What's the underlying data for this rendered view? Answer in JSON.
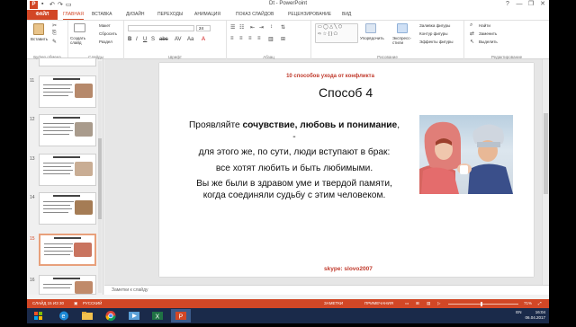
{
  "window": {
    "title": "Dt - PowerPoint",
    "app_icon": "P",
    "controls": [
      "?",
      "—",
      "❐",
      "✕"
    ]
  },
  "tabs": {
    "file": "ФАЙЛ",
    "items": [
      {
        "label": "ГЛАВНАЯ",
        "active": true
      },
      {
        "label": "ВСТАВКА"
      },
      {
        "label": "ДИЗАЙН"
      },
      {
        "label": "ПЕРЕХОДЫ"
      },
      {
        "label": "АНИМАЦИЯ"
      },
      {
        "label": "ПОКАЗ СЛАЙДОВ"
      },
      {
        "label": "РЕЦЕНЗИРОВАНИЕ"
      },
      {
        "label": "ВИД"
      }
    ]
  },
  "ribbon": {
    "clipboard": {
      "paste": "Вставить",
      "label": "Буфер обмена"
    },
    "slides": {
      "new_slide": "Создать слайд",
      "layout": "Макет",
      "reset": "Сбросить",
      "section": "Раздел",
      "label": "Слайды"
    },
    "font": {
      "label": "Шрифт",
      "size": "24"
    },
    "paragraph": {
      "label": "Абзац"
    },
    "drawing": {
      "arrange": "Упорядочить",
      "styles": "Экспресс-стили",
      "fill": "Заливка фигуры",
      "outline": "Контур фигуры",
      "effects": "Эффекты фигуры",
      "label": "Рисование"
    },
    "editing": {
      "find": "Найти",
      "replace": "Заменить",
      "select": "Выделить",
      "label": "Редактирование"
    }
  },
  "thumbnails": [
    {
      "number": "11"
    },
    {
      "number": "12"
    },
    {
      "number": "13"
    },
    {
      "number": "14"
    },
    {
      "number": "15",
      "active": true
    },
    {
      "number": "16"
    }
  ],
  "slide": {
    "header": "10 способов ухода от конфликта",
    "title": "Способ 4",
    "line1_pre": "Проявляйте ",
    "line1_bold": "сочувствие, любовь и понимание",
    "line1_post": ", -",
    "line2": "для этого же, по сути, люди вступают в брак:",
    "line3": "все хотят любить и быть любимыми.",
    "line4": "Вы же были в здравом уме и твердой памяти, когда соединяли судьбу с этим человеком.",
    "footer": "skype:  slovo2007"
  },
  "notes": {
    "placeholder": "Заметки к слайду"
  },
  "statusbar": {
    "slide_info": "СЛАЙД 15 ИЗ 30",
    "language": "РУССКИЙ",
    "notes": "ЗАМЕТКИ",
    "comments": "ПРИМЕЧАНИЯ",
    "zoom": "71%"
  },
  "taskbar": {
    "apps": [
      "ie-icon",
      "folder-icon",
      "chrome-icon",
      "media-icon",
      "excel-icon",
      "powerpoint-icon"
    ],
    "lang": "EN",
    "time": "16:04",
    "date": "06.04.2017"
  },
  "colors": {
    "accent": "#d24726",
    "taskbar": "#1a2a4a"
  }
}
